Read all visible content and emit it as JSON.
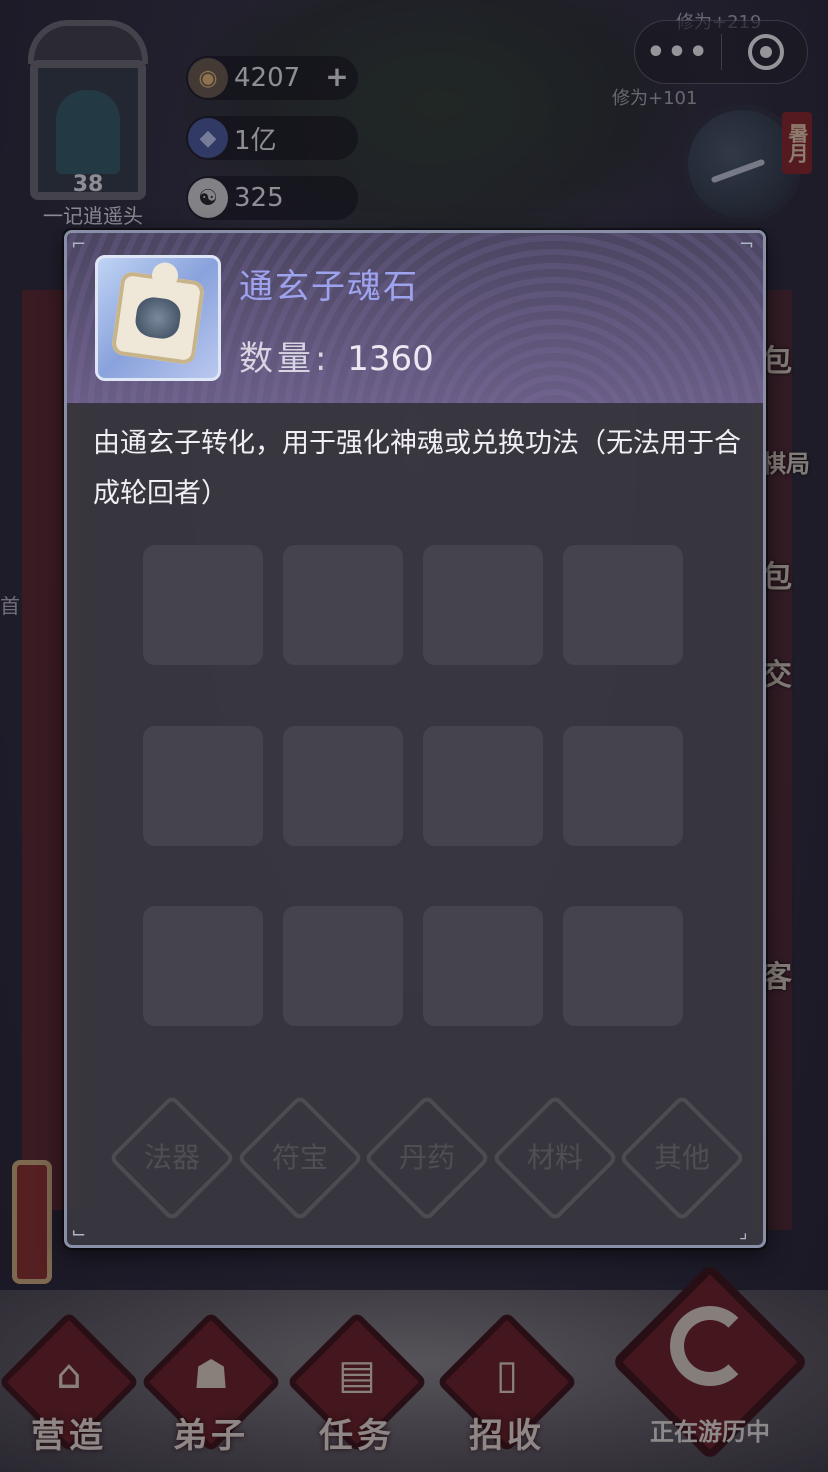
{
  "player": {
    "level": "38",
    "name": "一记逍遥头"
  },
  "resources": [
    {
      "icon": "spirit-stone-icon",
      "value": "4207",
      "has_plus": true
    },
    {
      "icon": "crystal-icon",
      "value": "1亿"
    },
    {
      "icon": "yin-yang-icon",
      "value": "325"
    }
  ],
  "floating_texts": [
    "修为+219",
    "修为+101"
  ],
  "season": "暑月",
  "side_buttons": [
    "包",
    "棋局",
    "包",
    "交",
    "客"
  ],
  "left_side_buttons": [
    "首"
  ],
  "dialog": {
    "item_name": "通玄子魂石",
    "quantity_label": "数量:",
    "quantity_value": "1360",
    "description": "由通玄子转化，用于强化神魂或兑换功法（无法用于合成轮回者）"
  },
  "ghost_tabs": [
    "法器",
    "符宝",
    "丹药",
    "材料",
    "其他"
  ],
  "bottom_nav": [
    {
      "label": "营造",
      "icon": "pavilion-icon"
    },
    {
      "label": "弟子",
      "icon": "disciple-icon"
    },
    {
      "label": "任务",
      "icon": "scroll-icon"
    },
    {
      "label": "招收",
      "icon": "card-icon"
    }
  ],
  "travel_status": "正在游历中",
  "colors": {
    "item_name": "#9ea3f0",
    "dialog_border": "#8a8fa8",
    "nav_red": "#6a1c1e"
  }
}
